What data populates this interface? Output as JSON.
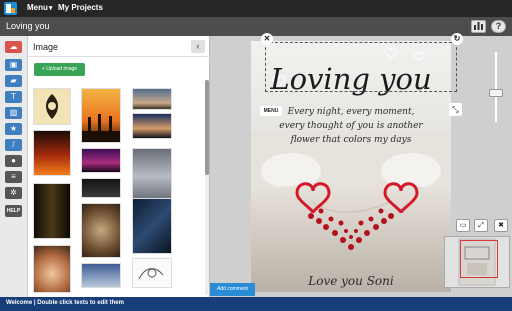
{
  "topbar": {
    "menu_label": "Menu",
    "projects_label": "My Projects"
  },
  "document": {
    "title": "Loving you"
  },
  "titlebar_buttons": {
    "chart_icon": "bar-chart-icon",
    "help_label": "?"
  },
  "toolbar": {
    "tools": [
      {
        "icon": "cloud-upload-icon",
        "glyph": "☁"
      },
      {
        "icon": "save-icon",
        "glyph": "▣"
      },
      {
        "icon": "folder-icon",
        "glyph": "▰"
      },
      {
        "icon": "text-icon",
        "glyph": "T"
      },
      {
        "icon": "image-icon",
        "glyph": "▨"
      },
      {
        "icon": "star-icon",
        "glyph": "★"
      },
      {
        "icon": "magic-wand-icon",
        "glyph": "/"
      },
      {
        "icon": "users-icon",
        "glyph": "●"
      },
      {
        "icon": "list-icon",
        "glyph": "≡"
      },
      {
        "icon": "gear-icon",
        "glyph": "✲"
      }
    ],
    "help_label": "HELP"
  },
  "image_panel": {
    "title": "Image",
    "collapse_glyph": "‹",
    "upload_label": "Upload image"
  },
  "card": {
    "title": "Loving you",
    "verse_lines": [
      "Every night, every moment,",
      "every thought of you is another",
      "flower that colors my days"
    ],
    "signature": "Love you Soni"
  },
  "canvas_controls": {
    "menu_label": "MENU",
    "close_glyph": "✕",
    "rotate_glyph": "↻",
    "expand_glyph": "⤡"
  },
  "view_buttons": [
    "▭",
    "⤢",
    "✖"
  ],
  "comment_button": "Add comment",
  "status": {
    "text": "Welcome | Double click texts to edit them"
  },
  "colors": {
    "accent": "#2b8cd6",
    "status_bar": "#173e78",
    "upload": "#39a356",
    "danger": "#d9534f"
  }
}
